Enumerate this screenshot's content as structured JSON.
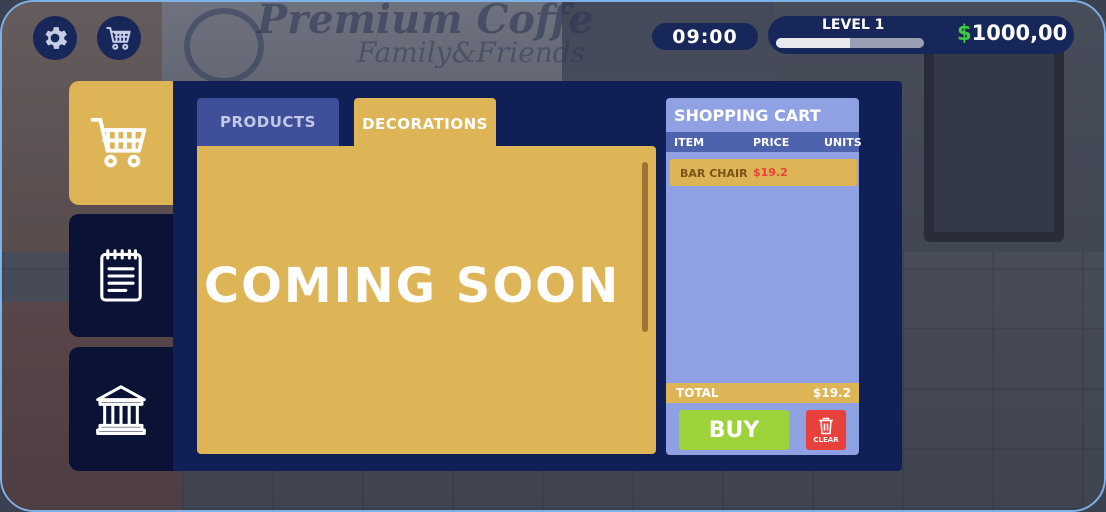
{
  "hud": {
    "settings_icon": "gear-icon",
    "shop_icon": "shopping-cart-icon",
    "time": "09:00",
    "level_label": "LEVEL 1",
    "level_progress": 0.5,
    "currency_symbol": "$",
    "money": "1000,00"
  },
  "background": {
    "banner_text": "Premium Coffe",
    "banner_sub": "Family&Friends"
  },
  "sidebar": {
    "items": [
      {
        "icon": "shopping-cart-icon",
        "active": true
      },
      {
        "icon": "notepad-icon",
        "active": false
      },
      {
        "icon": "bank-icon",
        "active": false
      }
    ]
  },
  "tabs": {
    "products": "PRODUCTS",
    "decorations": "DECORATIONS"
  },
  "content": {
    "message": "COMING SOON"
  },
  "cart": {
    "title": "SHOPPING CART",
    "columns": [
      "ITEM",
      "PRICE",
      "UNITS"
    ],
    "items": [
      {
        "name": "BAR CHAIR",
        "price": "$19.2",
        "units": ""
      }
    ],
    "total_label": "TOTAL",
    "total_value": "$19.2",
    "buy_label": "BUY",
    "clear_label": "CLEAR"
  },
  "colors": {
    "panel": "#101f56",
    "accent_gold": "#ddb456",
    "cart_bg": "#8fa1e3",
    "buy_green": "#9ed23a",
    "clear_red": "#e8403a",
    "money_green": "#3fcd3f"
  }
}
